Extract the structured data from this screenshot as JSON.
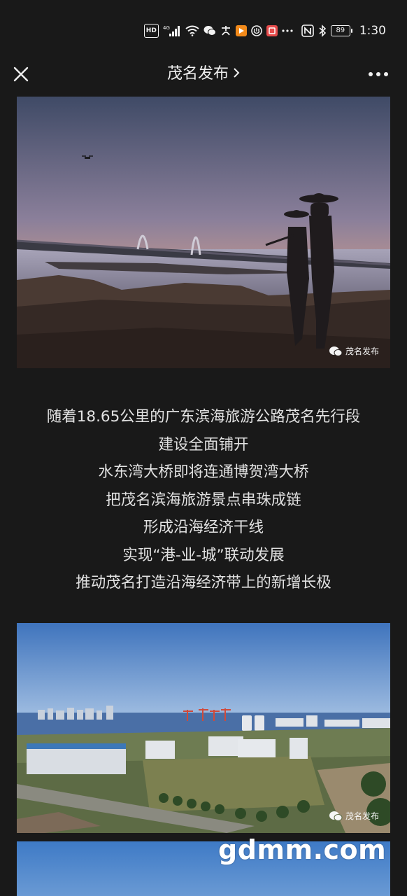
{
  "status_bar": {
    "hd_label": "HD",
    "network_label": "4G",
    "battery_level": "89",
    "time": "1:30",
    "icons": [
      "hd-icon",
      "signal-icon",
      "wifi-icon",
      "wechat-icon",
      "alipay-icon",
      "app-orange-icon",
      "app-shield-icon",
      "app-red-icon",
      "more-dots-icon",
      "nfc-icon",
      "bluetooth-icon",
      "battery-icon"
    ]
  },
  "nav": {
    "title": "茂名发布",
    "close_icon": "close-icon",
    "more_icon": "more-icon"
  },
  "images": [
    {
      "watermark": "茂名发布"
    },
    {
      "watermark": "茂名发布"
    }
  ],
  "article": {
    "lines": [
      "随着18.65公里的广东滨海旅游公路茂名先行段",
      "建设全面铺开",
      "水东湾大桥即将连通博贺湾大桥",
      "把茂名滨海旅游景点串珠成链",
      "形成沿海经济干线",
      "实现“港-业-城”联动发展",
      "推动茂名打造沿海经济带上的新增长极"
    ]
  },
  "site_watermark": "gdmm.com"
}
